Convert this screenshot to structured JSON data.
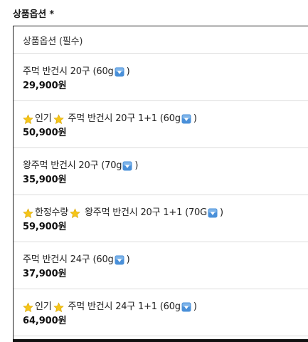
{
  "field": {
    "label": "상품옵션 *"
  },
  "dropdown": {
    "placeholder": "상품옵션 (필수)",
    "options": [
      {
        "badge": "",
        "name": "주먹 반건시 20구 (60g",
        "suffix": ")",
        "price": "29,900원"
      },
      {
        "badge": "인기",
        "name": "주먹 반건시 20구 1+1 (60g",
        "suffix": ")",
        "price": "50,900원"
      },
      {
        "badge": "",
        "name": "왕주먹 반건시 20구 (70g",
        "suffix": ")",
        "price": "35,900원"
      },
      {
        "badge": "한정수량",
        "name": "왕주먹 반건시 20구 1+1 (70G",
        "suffix": ")",
        "price": "59,900원"
      },
      {
        "badge": "",
        "name": "주먹 반건시 24구 (60g",
        "suffix": ")",
        "price": "37,900원"
      },
      {
        "badge": "인기",
        "name": "주먹 반건시 24구 1+1 (60g",
        "suffix": ")",
        "price": "64,900원"
      }
    ]
  },
  "icons": {
    "badge_icon": "star-icon",
    "inline_icon": "down-arrow-box-icon"
  },
  "colors": {
    "border": "#1f1f1f",
    "divider": "#dcdcdc",
    "star": "#f5c518",
    "down_box": "#4a90d9"
  }
}
